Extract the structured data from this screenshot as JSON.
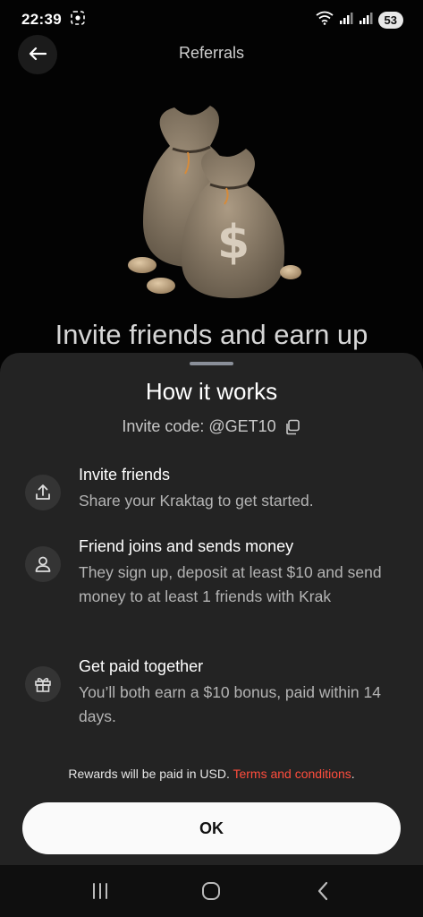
{
  "status_bar": {
    "time": "22:39",
    "battery": "53"
  },
  "header": {
    "title": "Referrals"
  },
  "hero": {
    "heading": "Invite friends and earn up"
  },
  "sheet": {
    "title": "How it works",
    "invite_code_label": "Invite code: @GET10",
    "steps": [
      {
        "title": "Invite friends",
        "description": "Share your Kraktag to get started.",
        "icon": "share-upload-icon"
      },
      {
        "title": "Friend joins and sends money",
        "description": "They sign up, deposit at least $10 and send money to at least 1 friends with Krak",
        "icon": "person-icon"
      },
      {
        "title": "Get paid together",
        "description": "You’ll both earn a $10 bonus, paid within 14 days.",
        "icon": "gift-icon"
      }
    ],
    "rewards_note": "Rewards will be paid in USD. ",
    "terms_link": "Terms and conditions",
    "note_end": ".",
    "ok_label": "OK"
  },
  "colors": {
    "sheet_bg": "#232323",
    "link": "#ff4d3d",
    "button_bg": "#fafafa"
  }
}
